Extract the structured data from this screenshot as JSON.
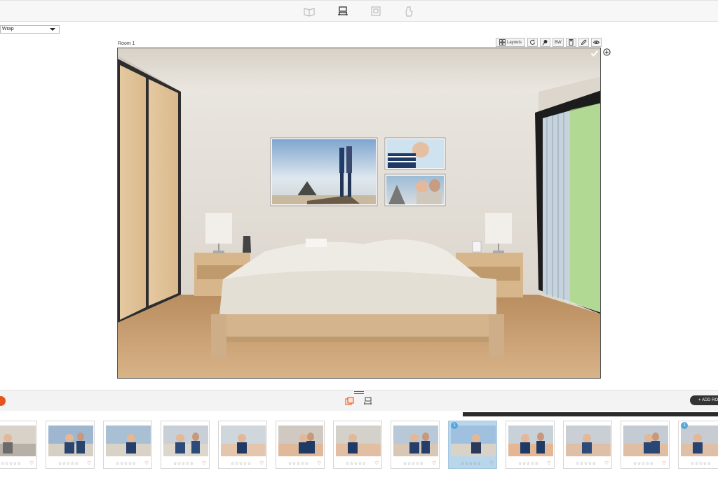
{
  "toolbar": {
    "icons": [
      "book-icon",
      "room-view-icon",
      "print-icon",
      "share-hand-icon"
    ],
    "active_icon": "room-view-icon"
  },
  "wrap_select": {
    "value": "Wrap"
  },
  "room": {
    "label": "Room 1"
  },
  "preview_tools": {
    "layouts_label": "Layouts",
    "bw_label": "BW",
    "icons": [
      "layouts-icon",
      "rotate-icon",
      "brush-icon",
      "bw-icon",
      "calculator-icon",
      "pencil-icon",
      "eye-icon"
    ]
  },
  "bottom": {
    "add_room_label": "+ ADD RO",
    "icons": [
      "gallery-icon",
      "room-photo-icon"
    ]
  },
  "filmstrip": {
    "stars": "☆☆☆☆☆",
    "heart": "♡",
    "thumbs": [
      {
        "subject": "beach-partial",
        "selected": false,
        "badge": ""
      },
      {
        "subject": "mother-child-beach",
        "selected": false,
        "badge": ""
      },
      {
        "subject": "child-sitting-sand",
        "selected": false,
        "badge": ""
      },
      {
        "subject": "child-crawling",
        "selected": false,
        "badge": ""
      },
      {
        "subject": "father-child-closeup",
        "selected": false,
        "badge": ""
      },
      {
        "subject": "child-striped-hug",
        "selected": false,
        "badge": ""
      },
      {
        "subject": "striped-shirt-closeup",
        "selected": false,
        "badge": ""
      },
      {
        "subject": "father-son-sand",
        "selected": false,
        "badge": ""
      },
      {
        "subject": "couple-rock",
        "selected": true,
        "badge": "1"
      },
      {
        "subject": "mother-father-child",
        "selected": false,
        "badge": ""
      },
      {
        "subject": "family-rock",
        "selected": false,
        "badge": ""
      },
      {
        "subject": "family-rock-2",
        "selected": false,
        "badge": ""
      },
      {
        "subject": "family-rock-3",
        "selected": false,
        "badge": "1"
      }
    ]
  },
  "colors": {
    "accent": "#e5541d",
    "selected_bg": "#b9d7ec",
    "badge": "#5aa5d8"
  }
}
